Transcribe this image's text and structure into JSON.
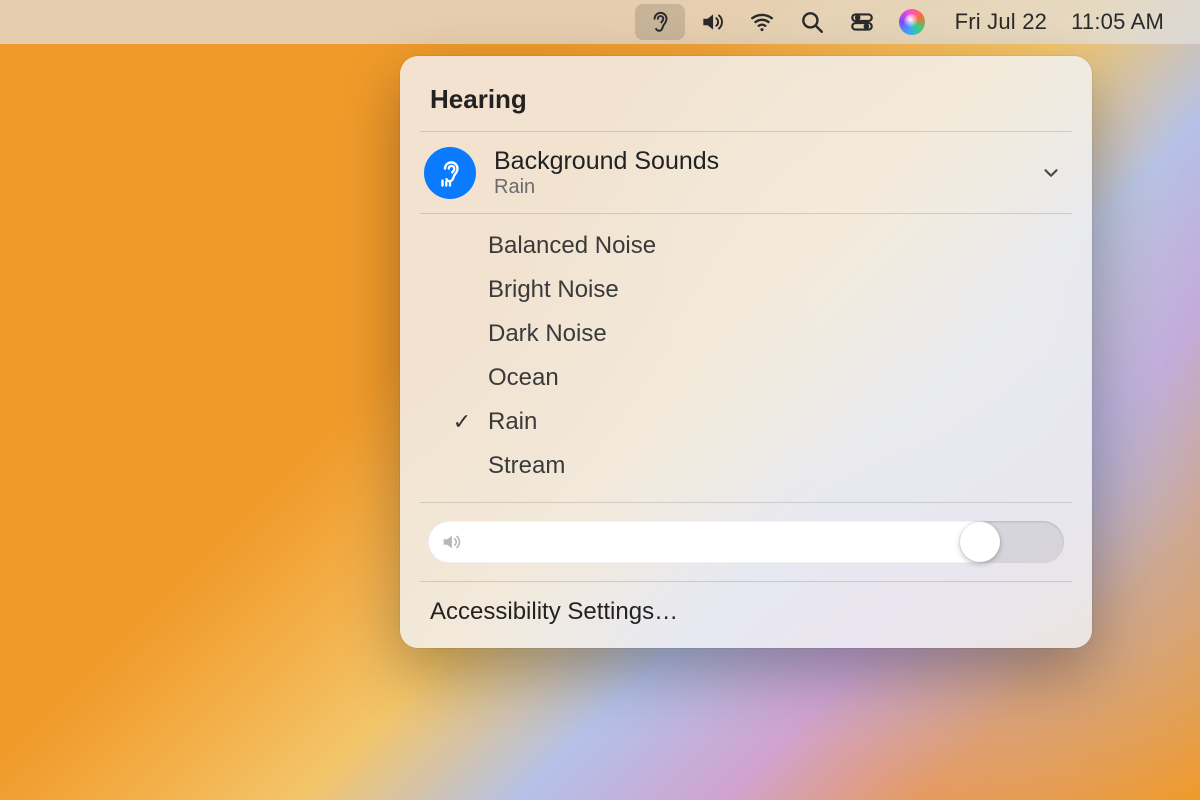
{
  "menubar": {
    "date": "Fri Jul 22",
    "time": "11:05 AM"
  },
  "panel": {
    "title": "Hearing",
    "bg_sounds": {
      "label": "Background Sounds",
      "current": "Rain"
    },
    "sounds": [
      {
        "label": "Balanced Noise",
        "selected": false
      },
      {
        "label": "Bright Noise",
        "selected": false
      },
      {
        "label": "Dark Noise",
        "selected": false
      },
      {
        "label": "Ocean",
        "selected": false
      },
      {
        "label": "Rain",
        "selected": true
      },
      {
        "label": "Stream",
        "selected": false
      }
    ],
    "volume_percent": 90,
    "settings_label": "Accessibility Settings…"
  },
  "colors": {
    "accent": "#0a7aff"
  }
}
